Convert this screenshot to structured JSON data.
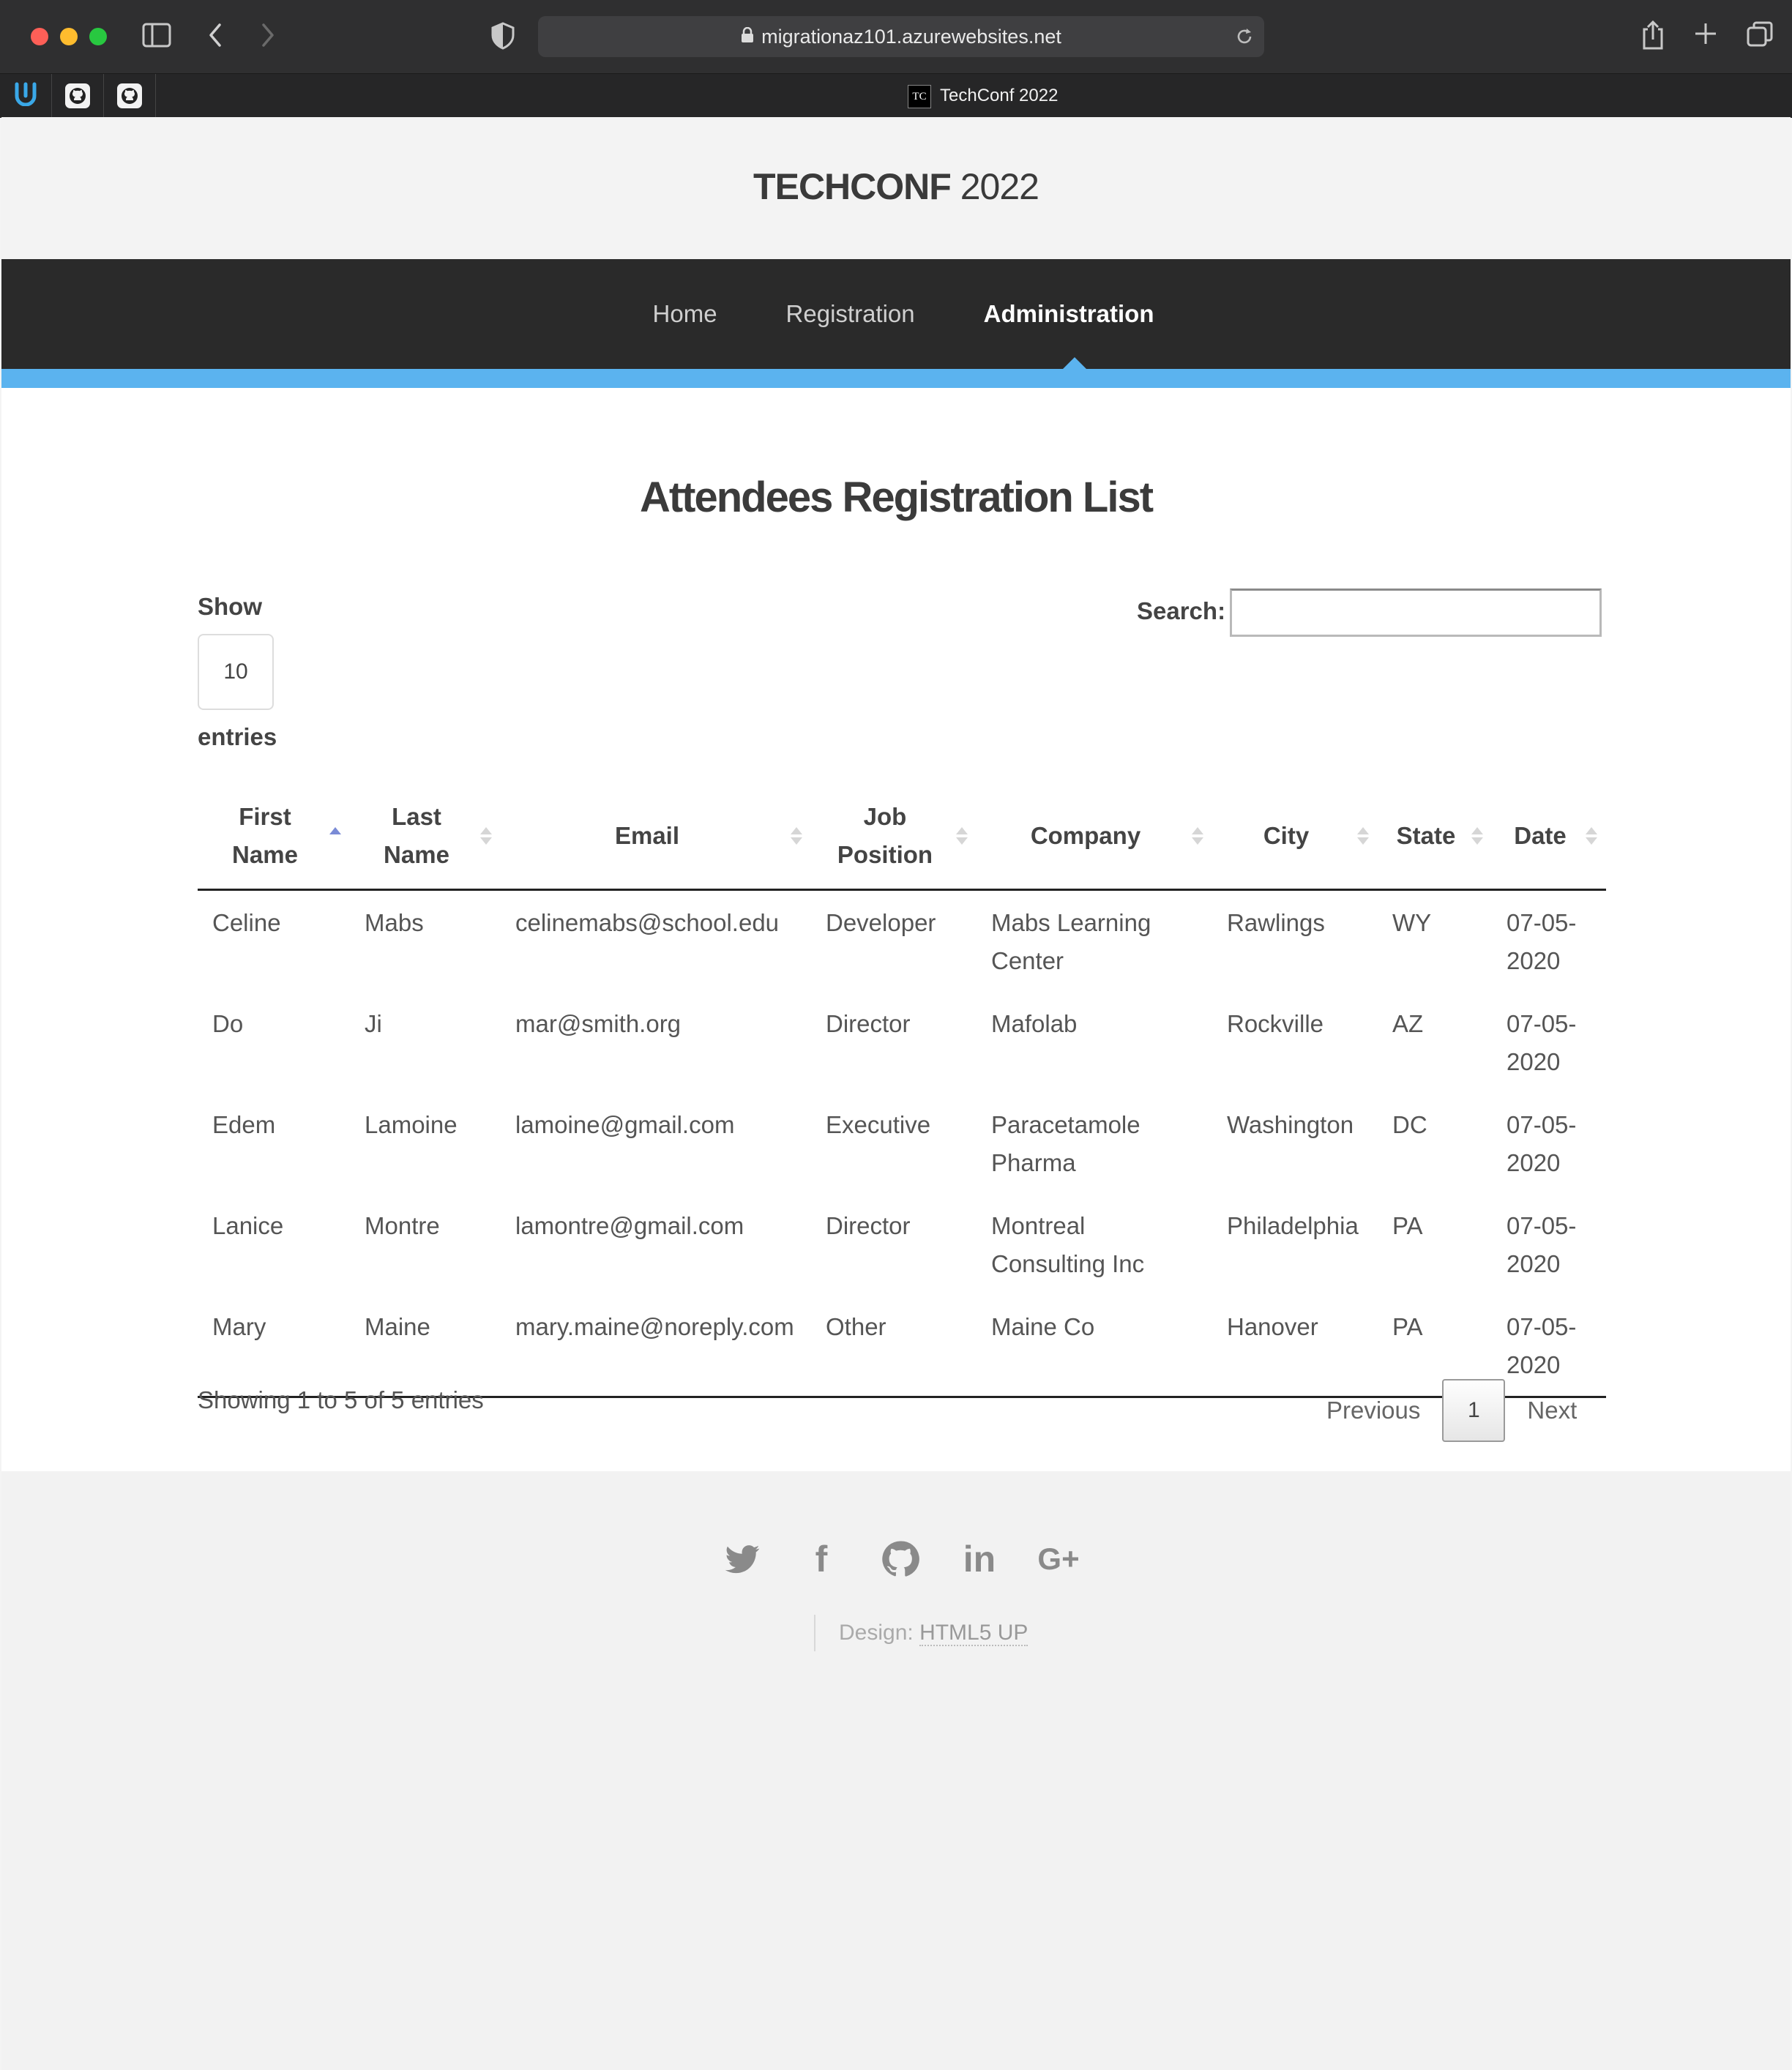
{
  "browser": {
    "url": "migrationaz101.azurewebsites.net",
    "tab_title": "TechConf 2022",
    "tab_favicon_text": "TC",
    "pinned_tabs": [
      "udacity-icon",
      "github-icon",
      "github-icon"
    ]
  },
  "site": {
    "logo_bold": "TECHCONF",
    "logo_light": " 2022"
  },
  "nav": {
    "items": [
      {
        "label": "Home",
        "active": false
      },
      {
        "label": "Registration",
        "active": false
      },
      {
        "label": "Administration",
        "active": true
      }
    ]
  },
  "main": {
    "title": "Attendees Registration List",
    "show_label": "Show",
    "page_length": "10",
    "entries_label": "entries",
    "search_label": "Search:",
    "search_value": ""
  },
  "table": {
    "columns": [
      {
        "label": "First\nName",
        "sort": "asc"
      },
      {
        "label": "Last\nName",
        "sort": "none"
      },
      {
        "label": "Email",
        "sort": "none"
      },
      {
        "label": "Job\nPosition",
        "sort": "none"
      },
      {
        "label": "Company",
        "sort": "none"
      },
      {
        "label": "City",
        "sort": "none"
      },
      {
        "label": "State",
        "sort": "none"
      },
      {
        "label": "Date",
        "sort": "none"
      }
    ],
    "rows": [
      [
        "Celine",
        "Mabs",
        "celinemabs@school.edu",
        "Developer",
        "Mabs Learning Center",
        "Rawlings",
        "WY",
        "07-05-2020"
      ],
      [
        "Do",
        "Ji",
        "mar@smith.org",
        "Director",
        "Mafolab",
        "Rockville",
        "AZ",
        "07-05-2020"
      ],
      [
        "Edem",
        "Lamoine",
        "lamoine@gmail.com",
        "Executive",
        "Paracetamole Pharma",
        "Washington",
        "DC",
        "07-05-2020"
      ],
      [
        "Lanice",
        "Montre",
        "lamontre@gmail.com",
        "Director",
        "Montreal Consulting Inc",
        "Philadelphia",
        "PA",
        "07-05-2020"
      ],
      [
        "Mary",
        "Maine",
        "mary.maine@noreply.com",
        "Other",
        "Maine Co",
        "Hanover",
        "PA",
        "07-05-2020"
      ]
    ]
  },
  "pagination": {
    "info": "Showing 1 to 5 of 5 entries",
    "previous": "Previous",
    "current_page": "1",
    "next": "Next"
  },
  "footer": {
    "social": [
      {
        "icon": "twitter-icon"
      },
      {
        "icon": "facebook-icon",
        "glyph": "f"
      },
      {
        "icon": "github-icon"
      },
      {
        "icon": "linkedin-icon",
        "glyph": "in"
      },
      {
        "icon": "google-plus-icon",
        "glyph": "G+"
      }
    ],
    "credit_prefix": "Design: ",
    "credit_link": "HTML5 UP"
  },
  "colors": {
    "nav_dark": "#2a2a2a",
    "accent_blue": "#5bb3ef",
    "sort_active": "#7a8bd6"
  }
}
